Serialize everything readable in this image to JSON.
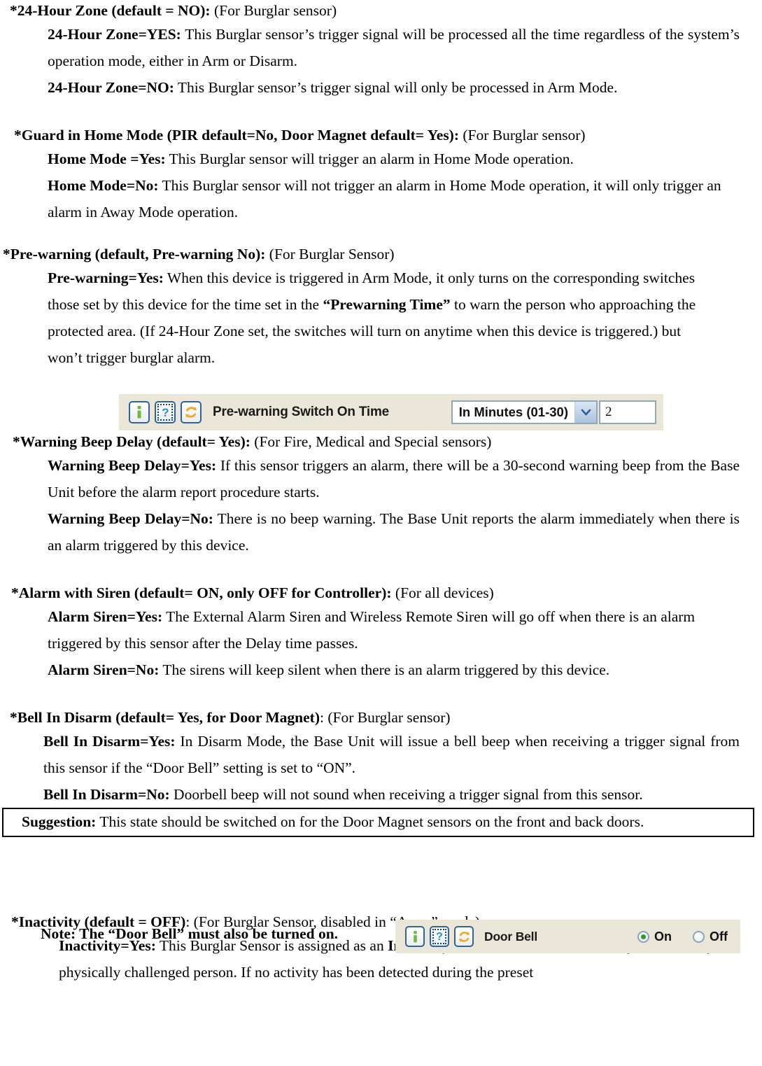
{
  "document": {
    "sections": [
      {
        "id": "24-hour-zone",
        "heading_bold": "*24-Hour Zone (default = NO):",
        "heading_plain": " (For Burglar sensor)",
        "paragraphs": [
          {
            "lead": "24-Hour Zone=YES:",
            "text": " This Burglar sensor’s trigger signal will be processed all the time regardless of the system’s operation mode, either in Arm or Disarm."
          },
          {
            "lead": "24-Hour Zone=NO:",
            "text": " This Burglar sensor’s trigger signal will only be processed in Arm Mode."
          }
        ]
      },
      {
        "id": "guard-in-home-mode",
        "heading_bold": "*Guard in Home Mode (PIR default=No, Door Magnet default= Yes):",
        "heading_plain": " (For Burglar sensor)",
        "paragraphs": [
          {
            "lead": "Home Mode =Yes:",
            "text": " This Burglar sensor will trigger an alarm in Home Mode operation."
          },
          {
            "lead": "Home Mode=No:",
            "text": " This Burglar sensor will not trigger an alarm in Home Mode operation, it will only trigger an alarm in Away Mode operation."
          }
        ]
      },
      {
        "id": "pre-warning",
        "heading_bold": "*Pre-warning (default, Pre-warning No):",
        "heading_plain": " (For Burglar Sensor)",
        "paragraphs": [
          {
            "lead": "Pre-warning=Yes:",
            "text_part1": " When this device is triggered in Arm Mode, it only turns on the corresponding switches those set by this device for the time set in the ",
            "emphasis": "“Prewarning Time”",
            "text_part2": " to warn the person who approaching the protected area. (If 24-Hour Zone set, the switches will turn on anytime when this device is triggered.) but won’t trigger burglar alarm."
          }
        ]
      },
      {
        "id": "warning-beep-delay",
        "heading_bold": "*Warning Beep Delay (default= Yes):",
        "heading_plain": " (For Fire, Medical and Special sensors)",
        "paragraphs": [
          {
            "lead": "Warning Beep Delay=Yes:",
            "text": " If this sensor triggers an alarm, there will be a 30-second warning beep from the Base Unit before the alarm report procedure starts."
          },
          {
            "lead": "Warning Beep Delay=No:",
            "text": " There is no beep warning. The Base Unit reports the alarm immediately when there is an alarm triggered by this device."
          }
        ]
      },
      {
        "id": "alarm-with-siren",
        "heading_bold": "*Alarm with Siren (default= ON, only OFF for Controller):",
        "heading_plain": " (For all devices)",
        "paragraphs": [
          {
            "lead": "Alarm Siren=Yes:",
            "text": " The External Alarm Siren and Wireless Remote Siren will go off when there is an alarm triggered by this sensor after the Delay time passes."
          },
          {
            "lead": "Alarm Siren=No:",
            "text": " The sirens will keep silent when there is an alarm triggered by this device."
          }
        ]
      },
      {
        "id": "bell-in-disarm",
        "heading_bold": "*Bell In Disarm (default= Yes, for Door Magnet)",
        "heading_plain": ": (For Burglar sensor)",
        "paragraphs": [
          {
            "lead": "Bell In Disarm=Yes:",
            "text": " In Disarm Mode, the Base Unit will issue a bell beep when receiving a trigger signal from this sensor if the “Door Bell” setting is set to “ON”."
          },
          {
            "lead": "Bell In Disarm=No:",
            "text": " Doorbell beep will not sound when receiving a trigger signal from this sensor."
          }
        ]
      },
      {
        "id": "inactivity",
        "heading_bold": "*Inactivity (default = OFF)",
        "heading_plain": ": (For Burglar Sensor, disabled in “Away” mode)",
        "paragraphs": [
          {
            "lead": "Inactivity=Yes:",
            "text_part1": " This Burglar Sensor is assigned as an ",
            "emphasis": "Inactivity Sensor",
            "text_part2": " to monitor the activity of an elderly or physically challenged person. If no activity has been detected during the preset"
          }
        ]
      }
    ],
    "suggestion": {
      "lead": "Suggestion:",
      "text": " This state should be switched on for the Door Magnet sensors on the front and back doors."
    },
    "note": "Note: The “Door Bell” must also be turned on."
  },
  "widgets": {
    "prewarning_switch": {
      "label": "Pre-warning Switch On Time",
      "icons": [
        "info-icon",
        "help-icon",
        "refresh-icon"
      ],
      "dropdown_value": "In Minutes (01-30)",
      "input_value": "2"
    },
    "door_bell": {
      "label": "Door Bell",
      "icons": [
        "info-icon",
        "help-icon",
        "refresh-icon"
      ],
      "options": [
        {
          "label": "On",
          "selected": true
        },
        {
          "label": "Off",
          "selected": false
        }
      ]
    }
  },
  "colors": {
    "widget_background": "#ebe7d8",
    "icon_border": "#31639c",
    "info_glyph": "#6cbb3c",
    "help_glyph": "#2b8fc9",
    "refresh_glyph": "#f5a623",
    "radio_selected": "#2f9a2f",
    "field_border": "#8fa8bd"
  }
}
